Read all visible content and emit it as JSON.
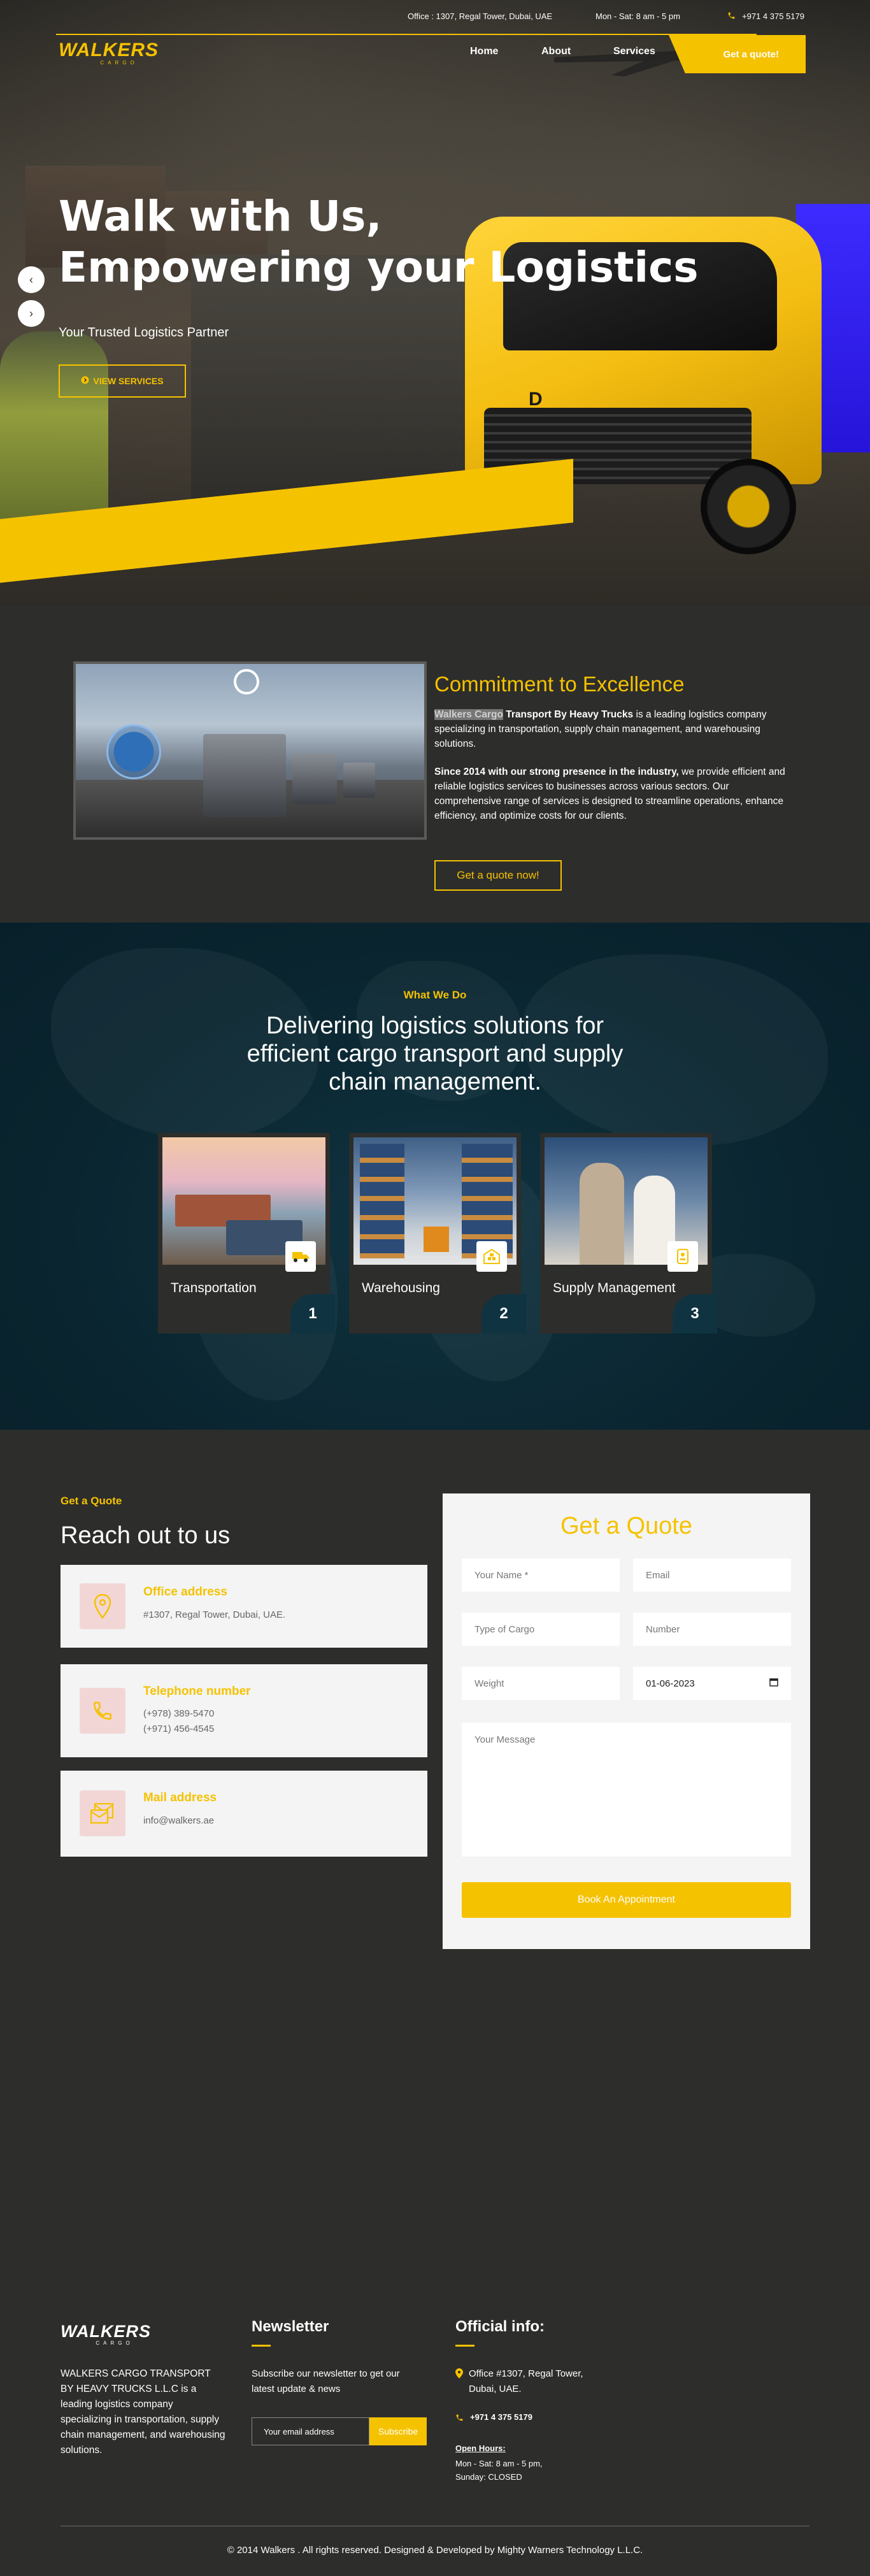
{
  "topbar": {
    "address": "Office : 1307, Regal Tower, Dubai, UAE",
    "hours": "Mon - Sat: 8 am - 5 pm",
    "phone": "+971 4 375 5179"
  },
  "brand": {
    "name": "WALKERS",
    "tagline": "CARGO"
  },
  "nav": {
    "items": [
      {
        "label": "Home"
      },
      {
        "label": "About"
      },
      {
        "label": "Services"
      }
    ],
    "quote_button": "Get a quote!"
  },
  "hero": {
    "title_line1": "Walk with Us,",
    "title_line2": "Empowering your Logistics",
    "subtitle": "Your Trusted Logistics Partner",
    "button": "VIEW SERVICES",
    "truck_letter": "D"
  },
  "commitment": {
    "title": "Commitment to Excellence",
    "p1_highlight": "Walkers Cargo",
    "p1_bold": " Transport By Heavy Trucks",
    "p1_rest": " is a leading logistics company specializing in transportation, supply chain management, and warehousing solutions.",
    "p2_bold": "Since 2014 with our strong presence in the industry,",
    "p2_rest": " we provide efficient and reliable logistics services to businesses across various sectors. Our comprehensive range of services is designed to streamline operations, enhance efficiency, and optimize costs for our clients.",
    "button": "Get a quote now!"
  },
  "services": {
    "label": "What We Do",
    "title": "Delivering logistics solutions for efficient cargo transport and supply chain management.",
    "items": [
      {
        "name": "Transportation",
        "number": "1",
        "icon": "truck-icon"
      },
      {
        "name": "Warehousing",
        "number": "2",
        "icon": "warehouse-icon"
      },
      {
        "name": "Supply Management",
        "number": "3",
        "icon": "supply-icon"
      }
    ]
  },
  "contact": {
    "label": "Get a Quote",
    "title": "Reach out to us",
    "office": {
      "heading": "Office address",
      "text": "#1307, Regal Tower, Dubai, UAE."
    },
    "phone": {
      "heading": "Telephone number",
      "line1": "(+978) 389-5470",
      "line2": "(+971) 456-4545"
    },
    "mail": {
      "heading": "Mail address",
      "text": "info@walkers.ae"
    }
  },
  "quote_form": {
    "title": "Get a Quote",
    "name_placeholder": "Your Name *",
    "email_placeholder": "Email",
    "cargo_placeholder": "Type of Cargo",
    "number_placeholder": "Number",
    "weight_placeholder": "Weight",
    "date_value": "01-06-2023",
    "message_placeholder": "Your Message",
    "submit": "Book An Appointment"
  },
  "footer": {
    "about": "WALKERS CARGO TRANSPORT BY HEAVY TRUCKS L.L.C is a leading logistics company specializing in transportation, supply chain management, and warehousing solutions.",
    "newsletter_heading": "Newsletter",
    "newsletter_text": "Subscribe our newsletter to get our latest update & news",
    "email_placeholder": "Your email address",
    "subscribe": "Subscribe",
    "official_heading": "Official info:",
    "address": "Office #1307, Regal Tower, Dubai, UAE.",
    "phone": "+971 4 375 5179",
    "open_hours_label": "Open Hours:",
    "open_hours_line1": "Mon - Sat: 8 am - 5 pm,",
    "open_hours_line2": "Sunday: CLOSED",
    "copyright": "© 2014 Walkers . All rights reserved. Designed & Developed by Mighty Warners Technology L.L.C."
  },
  "colors": {
    "accent": "#f5c200",
    "dark": "#2d2d2b",
    "navy": "#0a2530",
    "light": "#f4f4f4"
  }
}
